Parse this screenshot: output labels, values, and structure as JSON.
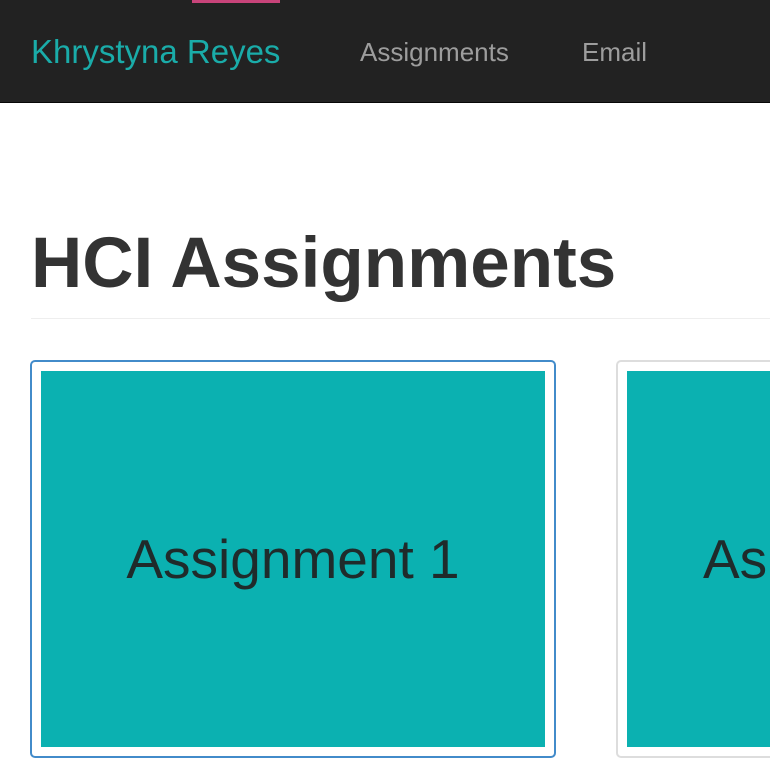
{
  "navbar": {
    "brand": "Khrystyna Reyes",
    "links": [
      {
        "label": "Assignments"
      },
      {
        "label": "Email"
      }
    ],
    "accent_color": "#c8447a"
  },
  "main": {
    "title": "HCI Assignments",
    "assignments": [
      {
        "label": "Assignment 1",
        "state": "active"
      },
      {
        "label": "As",
        "state": "partially-visible"
      }
    ]
  },
  "colors": {
    "navbar_bg": "#222222",
    "brand": "#1aaca9",
    "nav_link": "#9d9d9d",
    "tile": "#0bb1b1",
    "active_border": "#428bca"
  }
}
